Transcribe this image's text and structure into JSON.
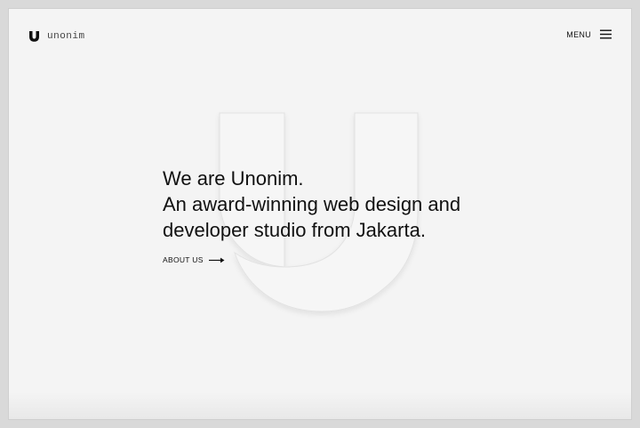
{
  "header": {
    "brand_name": "unonim",
    "menu_label": "MENU"
  },
  "hero": {
    "line1": "We are Unonim.",
    "line2": "An award-winning web design and",
    "line3": "developer studio from Jakarta.",
    "cta_label": "ABOUT US"
  },
  "icons": {
    "logo": "unonim-u-mark-icon",
    "menu": "hamburger-menu-icon",
    "cta": "arrow-right-icon",
    "background": "large-u-watermark"
  },
  "colors": {
    "background": "#f4f4f4",
    "text": "#111111",
    "watermark_stroke": "#e6e6e6"
  }
}
